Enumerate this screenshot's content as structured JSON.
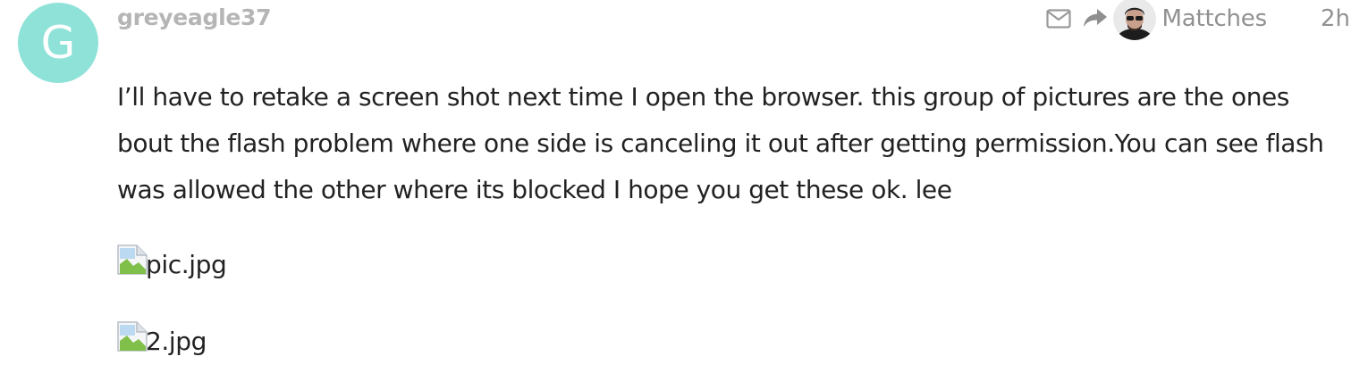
{
  "post": {
    "author": {
      "username": "greyeagle37",
      "avatar_letter": "G",
      "avatar_color": "#8ee2d8",
      "username_color": "#b5b5b5"
    },
    "reply_to": {
      "name": "Mattches"
    },
    "date": "2h",
    "icons": {
      "mail": "mail-icon",
      "reply": "reply-arrow-icon",
      "broken_image": "broken-image-icon"
    },
    "body": "I’ll have to retake a screen shot next time I open the browser. this group of pictures are the ones bout the flash problem where one side is canceling it out after getting permission.You can see flash was allowed the other where its blocked I hope you get these ok. lee",
    "attachments": [
      {
        "alt": "pic.jpg"
      },
      {
        "alt": "2.jpg"
      }
    ]
  }
}
